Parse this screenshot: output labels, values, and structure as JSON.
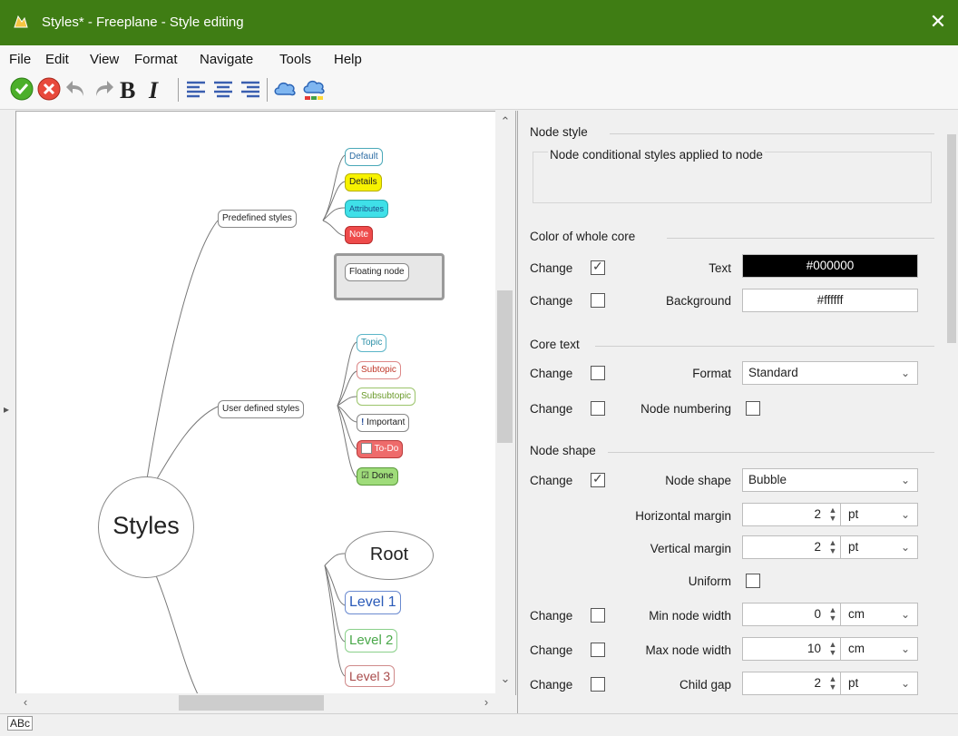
{
  "window": {
    "title": "Styles* - Freeplane - Style editing",
    "colors": {
      "titlebar": "#3f7d14"
    }
  },
  "menu": [
    "File",
    "Edit",
    "View",
    "Format",
    "Navigate",
    "Tools",
    "Help"
  ],
  "toolbar": {
    "icons": [
      "accept-icon",
      "reject-icon",
      "undo-icon",
      "redo-icon",
      "bold-icon",
      "italic-icon",
      "align-left-icon",
      "align-center-icon",
      "align-right-icon",
      "cloud-icon",
      "cloud-color-icon"
    ],
    "bold_label": "B",
    "italic_label": "I"
  },
  "map": {
    "root": "Styles",
    "groups": [
      {
        "label": "Predefined styles",
        "children": [
          "Default",
          "Details",
          "Attributes",
          "Note",
          "Floating node"
        ]
      },
      {
        "label": "User defined styles",
        "children": [
          "Topic",
          "Subtopic",
          "Subsubtopic",
          "Important",
          "To-Do",
          "Done"
        ]
      }
    ],
    "levels": [
      "Root",
      "Level 1",
      "Level 2",
      "Level 3"
    ]
  },
  "props": {
    "node_style": {
      "section": "Node style",
      "conditional": "Node conditional styles applied to node"
    },
    "color": {
      "section": "Color of whole core",
      "change_label": "Change",
      "text_label": "Text",
      "text_value": "#000000",
      "text_checked": true,
      "bg_label": "Background",
      "bg_value": "#ffffff",
      "bg_checked": false
    },
    "core_text": {
      "section": "Core text",
      "change_label": "Change",
      "format_label": "Format",
      "format_value": "Standard",
      "numbering_label": "Node numbering"
    },
    "node_shape": {
      "section": "Node shape",
      "change_label": "Change",
      "shape_label": "Node shape",
      "shape_value": "Bubble",
      "hmargin_label": "Horizontal margin",
      "hmargin_value": "2",
      "hmargin_unit": "pt",
      "vmargin_label": "Vertical margin",
      "vmargin_value": "2",
      "vmargin_unit": "pt",
      "uniform_label": "Uniform",
      "minw_label": "Min node width",
      "minw_value": "0",
      "minw_unit": "cm",
      "maxw_label": "Max node width",
      "maxw_value": "10",
      "maxw_unit": "cm",
      "gap_label": "Child gap",
      "gap_value": "2",
      "gap_unit": "pt"
    }
  },
  "status": {
    "abc": "ABc"
  }
}
